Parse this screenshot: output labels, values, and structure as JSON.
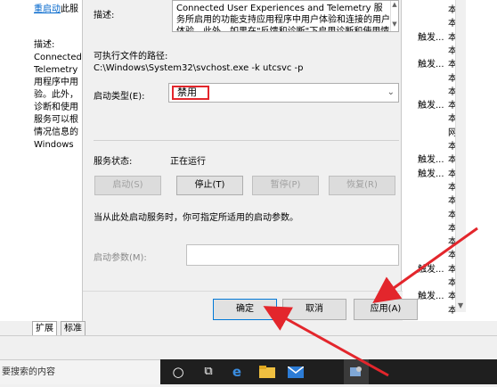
{
  "left_panel": {
    "link_text": "重启动",
    "link_suffix": "此服",
    "desc_label": "描述:",
    "desc_lines": [
      "Connected",
      "Telemetry",
      "用程序中用",
      "验。此外，",
      "诊断和使用",
      "服务可以根",
      "情况信息的",
      "Windows"
    ]
  },
  "right_panel": {
    "rows": [
      {
        "a": "",
        "b": "本"
      },
      {
        "a": "",
        "b": "本"
      },
      {
        "a": "触发...",
        "b": "本"
      },
      {
        "a": "",
        "b": "本"
      },
      {
        "a": "触发...",
        "b": "本"
      },
      {
        "a": "",
        "b": "本"
      },
      {
        "a": "",
        "b": "本"
      },
      {
        "a": "触发...",
        "b": "本"
      },
      {
        "a": "",
        "b": "本"
      },
      {
        "a": "",
        "b": "网"
      },
      {
        "a": "",
        "b": "本"
      },
      {
        "a": "触发...",
        "b": "本"
      },
      {
        "a": "触发...",
        "b": "本"
      },
      {
        "a": "",
        "b": "本"
      },
      {
        "a": "",
        "b": "本"
      },
      {
        "a": "",
        "b": "本"
      },
      {
        "a": "",
        "b": "本"
      },
      {
        "a": "",
        "b": "本"
      },
      {
        "a": "",
        "b": "本"
      },
      {
        "a": "触发...",
        "b": "本"
      },
      {
        "a": "",
        "b": "本"
      },
      {
        "a": "触发...",
        "b": "本"
      },
      {
        "a": "",
        "b": "本"
      }
    ]
  },
  "dialog": {
    "desc_label": "描述:",
    "description": "Connected User Experiences and Telemetry 服务所启用的功能支持应用程序中用户体验和连接的用户体验。此外，如果在\"反馈和诊断\"下启用诊断和使用情况",
    "exe_path_label": "可执行文件的路径:",
    "exe_path": "C:\\Windows\\System32\\svchost.exe -k utcsvc -p",
    "startup_type_label": "启动类型(E):",
    "startup_type_value": "禁用",
    "service_status_label": "服务状态:",
    "service_status_value": "正在运行",
    "buttons": {
      "start": "启动(S)",
      "stop": "停止(T)",
      "pause": "暂停(P)",
      "resume": "恢复(R)"
    },
    "hint": "当从此处启动服务时，你可指定所适用的启动参数。",
    "param_label": "启动参数(M):",
    "param_value": "",
    "footer": {
      "ok": "确定",
      "cancel": "取消",
      "apply": "应用(A)"
    }
  },
  "tabs": [
    "扩展",
    "标准"
  ],
  "taskbar": {
    "search_placeholder": "要搜索的内容"
  },
  "colors": {
    "highlight_border": "#e3262c",
    "arrow": "#e3262c",
    "accent": "#0078d7"
  }
}
